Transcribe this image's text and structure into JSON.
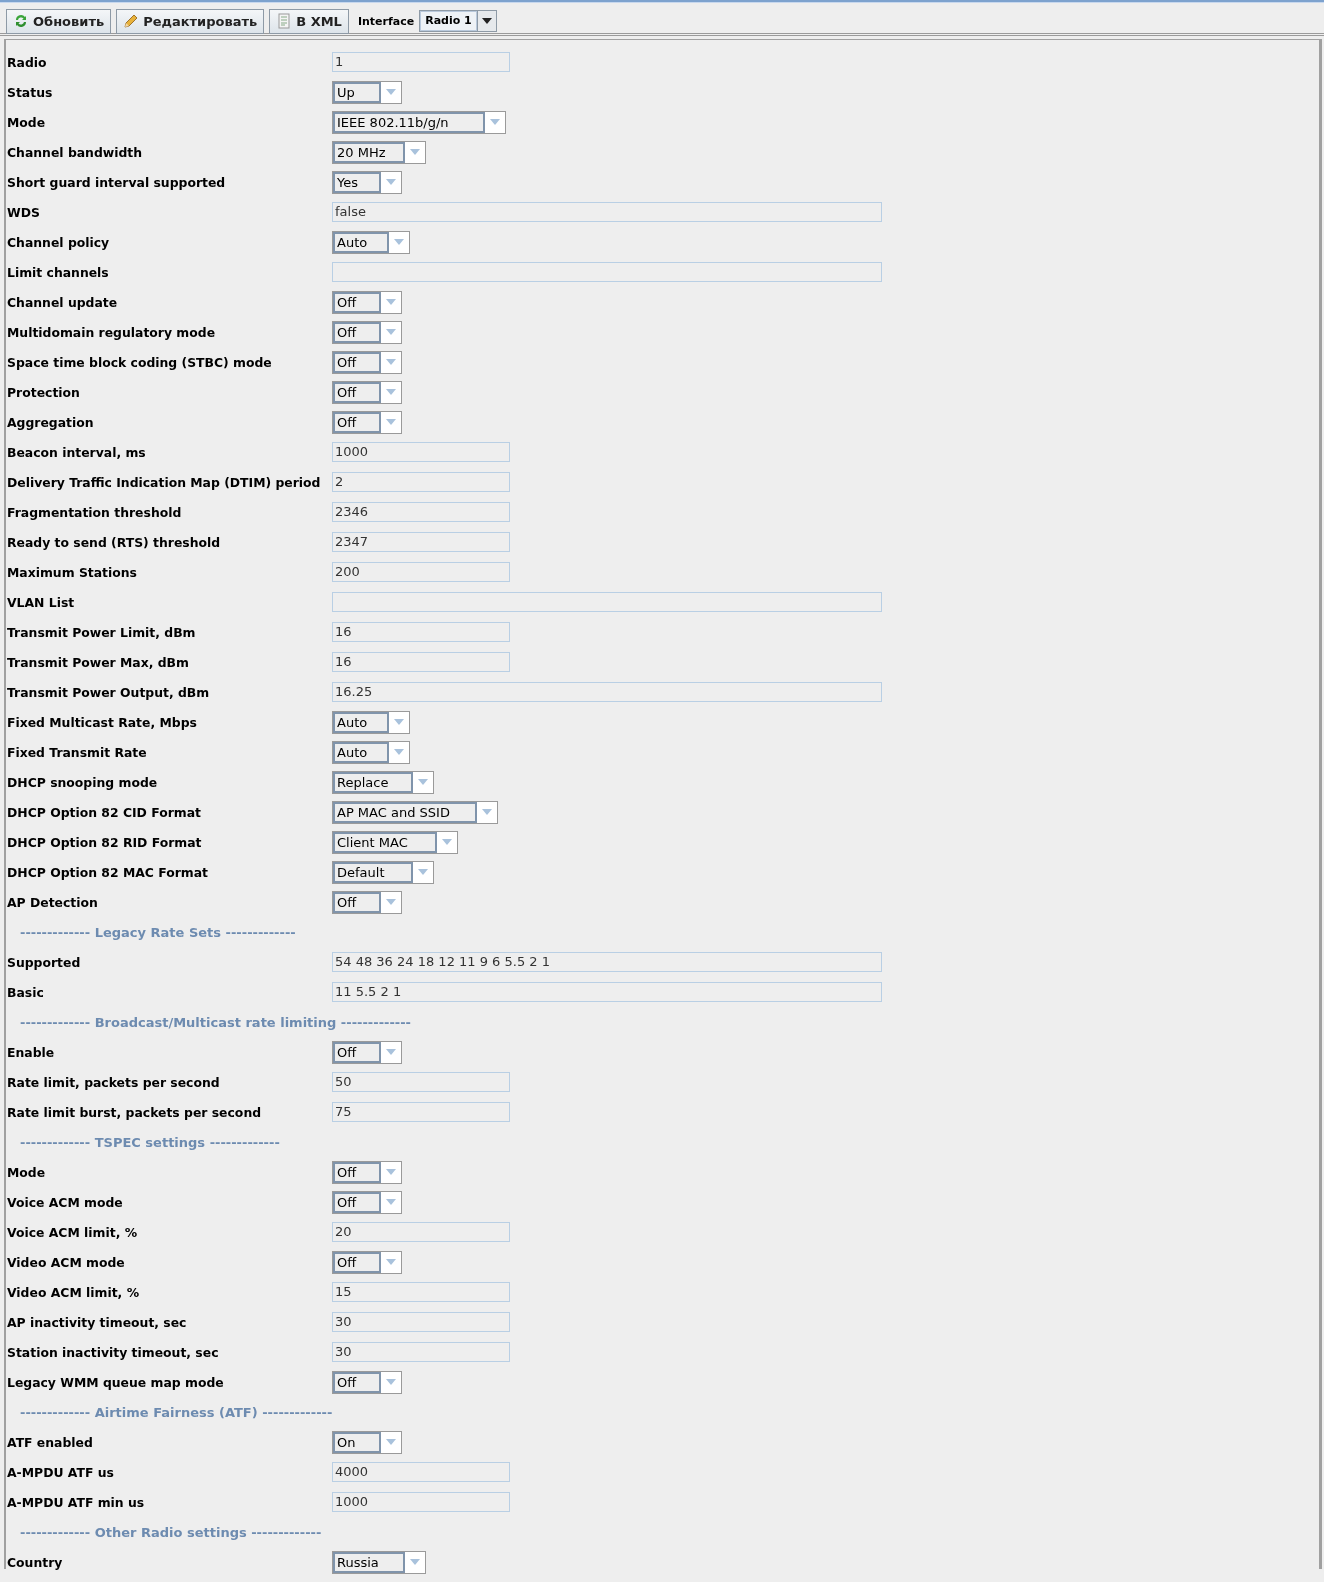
{
  "toolbar": {
    "buttons": [
      {
        "kind": "refresh",
        "label": "Обновить"
      },
      {
        "kind": "edit",
        "label": "Редактировать"
      },
      {
        "kind": "xml",
        "label": "В XML"
      }
    ],
    "interface_label": "Interface",
    "interface_value": "Radio 1"
  },
  "rows": [
    {
      "kind": "text",
      "label": "Radio",
      "value": "1"
    },
    {
      "kind": "select",
      "label": "Status",
      "value": "Up"
    },
    {
      "kind": "select",
      "label": "Mode",
      "value": "IEEE 802.11b/g/n"
    },
    {
      "kind": "select",
      "label": "Channel bandwidth",
      "value": "20 MHz"
    },
    {
      "kind": "select",
      "label": "Short guard interval supported",
      "value": "Yes"
    },
    {
      "kind": "wide",
      "label": "WDS",
      "value": "false"
    },
    {
      "kind": "select",
      "label": "Channel policy",
      "value": "Auto"
    },
    {
      "kind": "wide",
      "label": "Limit channels"
    },
    {
      "kind": "select",
      "label": "Channel update",
      "value": "Off"
    },
    {
      "kind": "select",
      "label": "Multidomain regulatory mode",
      "value": "Off"
    },
    {
      "kind": "select",
      "label": "Space time block coding (STBC) mode",
      "value": "Off"
    },
    {
      "kind": "select",
      "label": "Protection",
      "value": "Off"
    },
    {
      "kind": "select",
      "label": "Aggregation",
      "value": "Off"
    },
    {
      "kind": "text",
      "label": "Beacon interval, ms",
      "value": "1000"
    },
    {
      "kind": "text",
      "label": "Delivery Traffic Indication Map (DTIM) period",
      "value": "2"
    },
    {
      "kind": "text",
      "label": "Fragmentation threshold",
      "value": "2346"
    },
    {
      "kind": "text",
      "label": "Ready to send (RTS) threshold",
      "value": "2347"
    },
    {
      "kind": "text",
      "label": "Maximum Stations",
      "value": "200"
    },
    {
      "kind": "wide",
      "label": "VLAN List"
    },
    {
      "kind": "text",
      "label": "Transmit Power Limit, dBm",
      "value": "16"
    },
    {
      "kind": "text",
      "label": "Transmit Power Max, dBm",
      "value": "16"
    },
    {
      "kind": "wide",
      "label": "Transmit Power Output, dBm",
      "value": "16.25"
    },
    {
      "kind": "select",
      "label": "Fixed Multicast Rate, Mbps",
      "value": "Auto"
    },
    {
      "kind": "select",
      "label": "Fixed Transmit Rate",
      "value": "Auto"
    },
    {
      "kind": "select",
      "label": "DHCP snooping mode",
      "value": "Replace"
    },
    {
      "kind": "select",
      "label": "DHCP Option 82 CID Format",
      "value": "AP MAC and SSID"
    },
    {
      "kind": "select",
      "label": "DHCP Option 82 RID Format",
      "value": "Client MAC"
    },
    {
      "kind": "select",
      "label": "DHCP Option 82 MAC Format",
      "value": "Default"
    },
    {
      "kind": "select",
      "label": "AP Detection",
      "value": "Off"
    },
    {
      "kind": "section",
      "label": "------------- Legacy Rate Sets -------------"
    },
    {
      "kind": "wide",
      "label": "Supported",
      "value": "54 48 36 24 18 12 11 9 6 5.5 2 1"
    },
    {
      "kind": "wide",
      "label": "Basic",
      "value": "11 5.5 2 1"
    },
    {
      "kind": "section",
      "label": "------------- Broadcast/Multicast rate limiting -------------"
    },
    {
      "kind": "select",
      "label": "Enable",
      "value": "Off"
    },
    {
      "kind": "text",
      "label": "Rate limit, packets per second",
      "value": "50"
    },
    {
      "kind": "text",
      "label": "Rate limit burst, packets per second",
      "value": "75"
    },
    {
      "kind": "section",
      "label": "------------- TSPEC settings -------------"
    },
    {
      "kind": "select",
      "label": "Mode",
      "value": "Off"
    },
    {
      "kind": "select",
      "label": "Voice ACM mode",
      "value": "Off"
    },
    {
      "kind": "text",
      "label": "Voice ACM limit, %",
      "value": "20"
    },
    {
      "kind": "select",
      "label": "Video ACM mode",
      "value": "Off"
    },
    {
      "kind": "text",
      "label": "Video ACM limit, %",
      "value": "15"
    },
    {
      "kind": "text",
      "label": "AP inactivity timeout, sec",
      "value": "30"
    },
    {
      "kind": "text",
      "label": "Station inactivity timeout, sec",
      "value": "30"
    },
    {
      "kind": "select",
      "label": "Legacy WMM queue map mode",
      "value": "Off"
    },
    {
      "kind": "section",
      "label": "------------- Airtime Fairness (ATF) -------------"
    },
    {
      "kind": "select",
      "label": "ATF enabled",
      "value": "On"
    },
    {
      "kind": "text",
      "label": "A-MPDU ATF us",
      "value": "4000"
    },
    {
      "kind": "text",
      "label": "A-MPDU ATF min us",
      "value": "1000"
    },
    {
      "kind": "section",
      "label": "------------- Other Radio settings -------------"
    },
    {
      "kind": "select",
      "label": "Country",
      "value": "Russia"
    }
  ]
}
